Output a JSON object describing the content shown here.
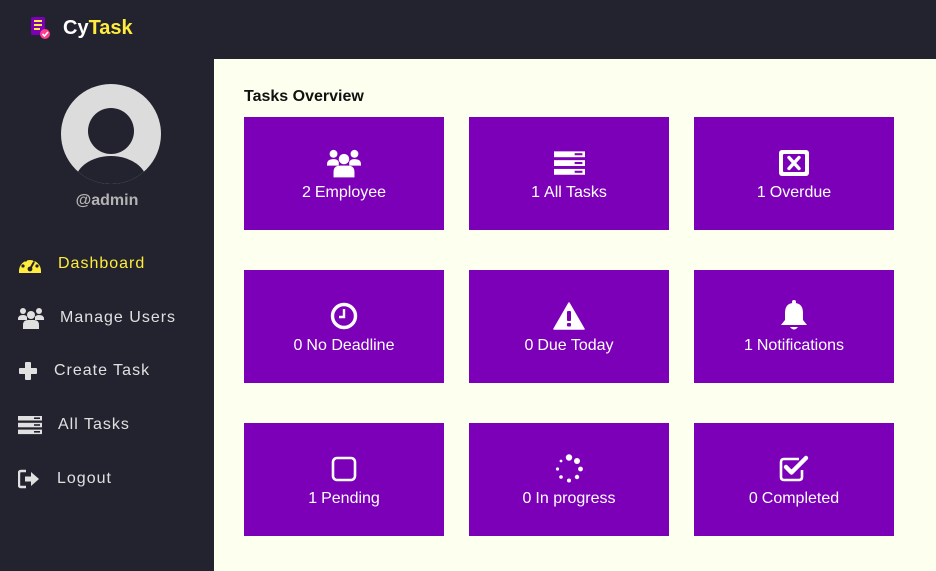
{
  "app": {
    "brand_prefix": "Cy",
    "brand_suffix": "Task",
    "accent_color": "#ffec3c",
    "card_color": "#7c00b7"
  },
  "sidebar": {
    "username": "@admin",
    "items": [
      {
        "label": "Dashboard",
        "icon": "tachometer-icon",
        "active": true
      },
      {
        "label": "Manage Users",
        "icon": "users-icon"
      },
      {
        "label": "Create Task",
        "icon": "plus-icon"
      },
      {
        "label": "All Tasks",
        "icon": "tasks-icon"
      },
      {
        "label": "Logout",
        "icon": "sign-out-icon"
      }
    ]
  },
  "main": {
    "title": "Tasks Overview",
    "cards": [
      {
        "count": "2",
        "label": "Employee",
        "icon": "users-icon"
      },
      {
        "count": "1",
        "label": "All Tasks",
        "icon": "tasks-icon"
      },
      {
        "count": "1",
        "label": "Overdue",
        "icon": "window-close-icon"
      },
      {
        "count": "0",
        "label": "No Deadline",
        "icon": "clock-icon"
      },
      {
        "count": "0",
        "label": "Due Today",
        "icon": "warning-icon"
      },
      {
        "count": "1",
        "label": "Notifications",
        "icon": "bell-icon"
      },
      {
        "count": "1",
        "label": "Pending",
        "icon": "square-icon"
      },
      {
        "count": "0",
        "label": "In progress",
        "icon": "spinner-icon"
      },
      {
        "count": "0",
        "label": "Completed",
        "icon": "check-square-icon"
      }
    ]
  }
}
